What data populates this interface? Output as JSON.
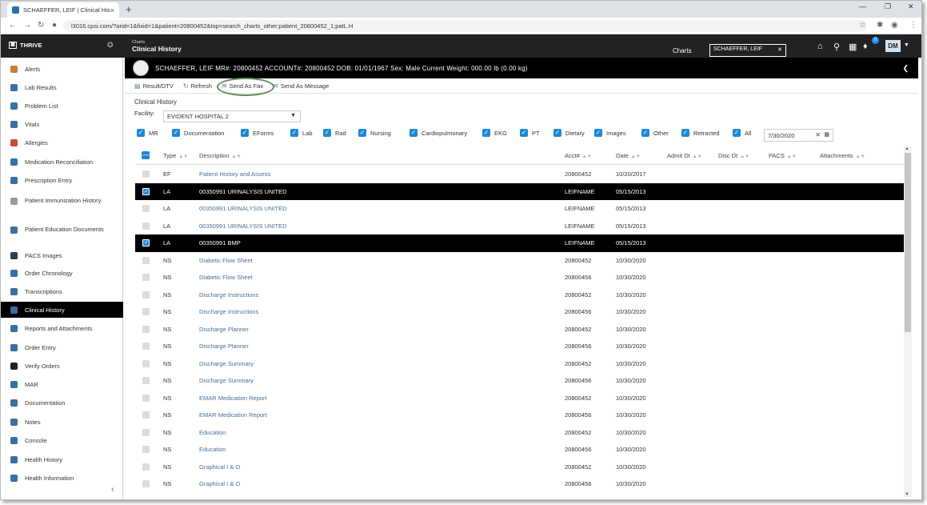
{
  "browser": {
    "tab_title": "SCHAEFFER, LEIF | Clinical Hist",
    "url": "l3016.cpsi.com/?arid=1&fixid=1&patient=20800452&top=search_charts_other;patient_20800452_1;patL.H",
    "new_tab": "+",
    "close": "×"
  },
  "header": {
    "brand": "THRIVE",
    "crumb_small": "Charts",
    "crumb_title": "Clinical History",
    "charts_link": "Charts",
    "patient_search": "SCHAEFFER, LEIF",
    "notification_count": "0",
    "user_initials": "DM"
  },
  "sidebar": {
    "items": [
      {
        "label": "Alerts",
        "icon": "alerts-icon",
        "color": "#c77c3a"
      },
      {
        "label": "Lab Results",
        "icon": "lab-results-icon",
        "color": "#3a6ea5"
      },
      {
        "label": "Problem List",
        "icon": "problem-list-icon",
        "color": "#3a6ea5"
      },
      {
        "label": "Vitals",
        "icon": "vitals-icon",
        "color": "#3a6ea5"
      },
      {
        "label": "Allergies",
        "icon": "allergies-icon",
        "color": "#c94a3a"
      },
      {
        "label": "Medication Reconciliation",
        "icon": "medication-reconciliation-icon",
        "color": "#3a6ea5"
      },
      {
        "label": "Prescription Entry",
        "icon": "prescription-entry-icon",
        "color": "#3a6ea5"
      },
      {
        "label": "Patient Immunization History",
        "icon": "immunization-icon",
        "color": "#9a9a9a"
      },
      {
        "label": "Patient Education Documents",
        "icon": "education-documents-icon",
        "color": "#3a6ea5"
      },
      {
        "label": "PACS Images",
        "icon": "pacs-images-icon",
        "color": "#2d3e50"
      },
      {
        "label": "Order Chronology",
        "icon": "order-chronology-icon",
        "color": "#3a6ea5"
      },
      {
        "label": "Transcriptions",
        "icon": "transcriptions-icon",
        "color": "#3a6ea5"
      },
      {
        "label": "Clinical History",
        "icon": "clinical-history-icon",
        "color": "#3a6ea5"
      },
      {
        "label": "Reports and Attachments",
        "icon": "reports-icon",
        "color": "#3a6ea5"
      },
      {
        "label": "Order Entry",
        "icon": "order-entry-icon",
        "color": "#3a6ea5"
      },
      {
        "label": "Verify Orders",
        "icon": "verify-orders-icon",
        "color": "#222222"
      },
      {
        "label": "MAR",
        "icon": "mar-icon",
        "color": "#3a6ea5"
      },
      {
        "label": "Documentation",
        "icon": "documentation-icon",
        "color": "#3a6ea5"
      },
      {
        "label": "Notes",
        "icon": "notes-icon",
        "color": "#3a6ea5"
      },
      {
        "label": "Console",
        "icon": "console-icon",
        "color": "#3a6ea5"
      },
      {
        "label": "Health History",
        "icon": "health-history-icon",
        "color": "#3a6ea5"
      },
      {
        "label": "Health Information",
        "icon": "health-information-icon",
        "color": "#3a6ea5"
      }
    ]
  },
  "banner": {
    "text": "SCHAEFFER, LEIF  MR#: 20800452  ACCOUNT#: 20800452  DOB: 01/01/1967  Sex: Male  Current Weight: 000.00 lb (0.00 kg)"
  },
  "toolbar": {
    "result_dtv": "Result/DTV",
    "refresh": "Refresh",
    "send_as_fax": "Send As Fax",
    "send_as_message": "Send As Message"
  },
  "section": {
    "title": "Clinical History",
    "facility_label": "Facility:",
    "facility_value": "EVIDENT HOSPITAL 2",
    "date_value": "7/30/2020"
  },
  "filters": [
    "MR",
    "Documentation",
    "EForms",
    "Lab",
    "Rad",
    "Nursing",
    "Cardiopulmonary",
    "EKG",
    "PT",
    "Dietary",
    "Images",
    "Other",
    "Retracted",
    "All"
  ],
  "table": {
    "columns": [
      "Type",
      "Description",
      "Acct#",
      "Date",
      "Admit Dt",
      "Disc Dt",
      "PACS",
      "Attachments"
    ],
    "rows": [
      {
        "type": "EF",
        "desc": "Patient History and Assess",
        "acct": "20800452",
        "date": "10/20/2017",
        "selected": false
      },
      {
        "type": "LA",
        "desc": "00350991 URINALYSIS UNITED",
        "acct": "LEIFNAME",
        "date": "05/15/2013",
        "selected": true
      },
      {
        "type": "LA",
        "desc": "00350991 URINALYSIS UNITED",
        "acct": "LEIFNAME",
        "date": "05/15/2013",
        "selected": false
      },
      {
        "type": "LA",
        "desc": "00350991 URINALYSIS UNITED",
        "acct": "LEIFNAME",
        "date": "05/15/2013",
        "selected": false
      },
      {
        "type": "LA",
        "desc": "00350991 BMP",
        "acct": "LEIFNAME",
        "date": "05/15/2013",
        "selected": true
      },
      {
        "type": "NS",
        "desc": "Diabetic Flow Sheet",
        "acct": "20800452",
        "date": "10/30/2020",
        "selected": false
      },
      {
        "type": "NS",
        "desc": "Diabetic Flow Sheet",
        "acct": "20800456",
        "date": "10/30/2020",
        "selected": false
      },
      {
        "type": "NS",
        "desc": "Discharge Instructions",
        "acct": "20800452",
        "date": "10/30/2020",
        "selected": false
      },
      {
        "type": "NS",
        "desc": "Discharge Instructions",
        "acct": "20800456",
        "date": "10/30/2020",
        "selected": false
      },
      {
        "type": "NS",
        "desc": "Discharge Planner",
        "acct": "20800452",
        "date": "10/30/2020",
        "selected": false
      },
      {
        "type": "NS",
        "desc": "Discharge Planner",
        "acct": "20800456",
        "date": "10/30/2020",
        "selected": false
      },
      {
        "type": "NS",
        "desc": "Discharge Summary",
        "acct": "20800452",
        "date": "10/30/2020",
        "selected": false
      },
      {
        "type": "NS",
        "desc": "Discharge Summary",
        "acct": "20800456",
        "date": "10/30/2020",
        "selected": false
      },
      {
        "type": "NS",
        "desc": "EMAR Medication Report",
        "acct": "20800452",
        "date": "10/30/2020",
        "selected": false
      },
      {
        "type": "NS",
        "desc": "EMAR Medication Report",
        "acct": "20800456",
        "date": "10/30/2020",
        "selected": false
      },
      {
        "type": "NS",
        "desc": "Education",
        "acct": "20800452",
        "date": "10/30/2020",
        "selected": false
      },
      {
        "type": "NS",
        "desc": "Education",
        "acct": "20800456",
        "date": "10/30/2020",
        "selected": false
      },
      {
        "type": "NS",
        "desc": "Graphical I & O",
        "acct": "20800452",
        "date": "10/30/2020",
        "selected": false
      },
      {
        "type": "NS",
        "desc": "Graphical I & O",
        "acct": "20800456",
        "date": "10/30/2020",
        "selected": false
      }
    ]
  },
  "colors": {
    "accent": "#1e88d8",
    "header_bg": "#222222",
    "selected_row": "#000000",
    "fax_highlight": "#5c8a55"
  }
}
